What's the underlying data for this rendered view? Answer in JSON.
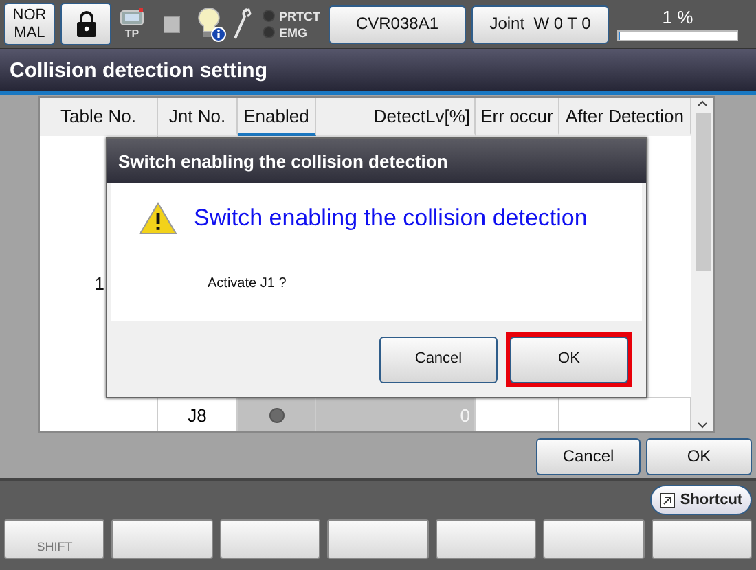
{
  "status_bar": {
    "mode_button": "NOR\nMAL",
    "tp_label": "TP",
    "lights": [
      {
        "label": "PRTCT",
        "on": false
      },
      {
        "label": "EMG",
        "on": false
      }
    ],
    "robot_button": "CVR038A1",
    "coord_button": "Joint  W 0 T 0",
    "speed": {
      "reading": "1 %",
      "level": 0.01
    }
  },
  "screen_title": "Collision detection setting",
  "table": {
    "columns": [
      {
        "label": "Table No.",
        "selected": false
      },
      {
        "label": "Jnt No.",
        "selected": false
      },
      {
        "label": "Enabled",
        "selected": true
      },
      {
        "label": "DetectLv[%]",
        "selected": false
      },
      {
        "label": "Err occur",
        "selected": false
      },
      {
        "label": "After Detection",
        "selected": false
      }
    ],
    "table_no": "1",
    "rows": [
      {
        "joint": "J8",
        "enabled": false,
        "detect_level": "0"
      }
    ]
  },
  "dialog": {
    "title": "Switch enabling the collision detection",
    "heading": "Switch enabling the collision detection",
    "message": "Activate J1 ?",
    "buttons": [
      {
        "label": "Cancel",
        "highlighted": false
      },
      {
        "label": "OK",
        "highlighted": true
      }
    ]
  },
  "buttons": [
    "Cancel",
    "OK"
  ],
  "shortcut": "Shortcut",
  "function_keys": [
    {
      "kind": "label",
      "label": "SHIFT"
    },
    {
      "kind": "blank"
    },
    {
      "kind": "blank"
    },
    {
      "kind": "blank"
    },
    {
      "kind": "blank"
    },
    {
      "kind": "blank"
    },
    {
      "kind": "blank"
    }
  ]
}
